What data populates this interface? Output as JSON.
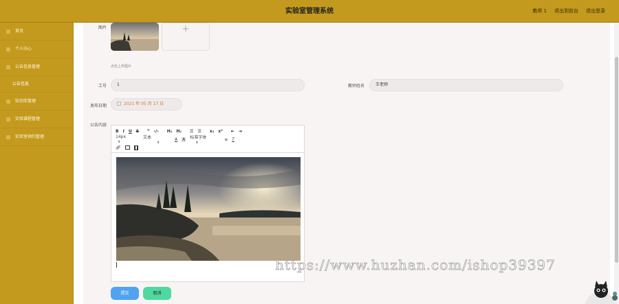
{
  "header": {
    "title": "实验室管理系统",
    "user_label": "教师 1",
    "back_to_front": "退出到前台",
    "logout": "退出登录"
  },
  "sidebar": {
    "items": [
      {
        "label": "首页",
        "icon": "home-icon"
      },
      {
        "label": "个人中心",
        "icon": "user-icon"
      },
      {
        "label": "公告信息管理",
        "icon": "notice-icon"
      },
      {
        "label": "公告信息",
        "sub": true
      },
      {
        "label": "知识库管理",
        "icon": "book-icon"
      },
      {
        "label": "实验课程管理",
        "icon": "course-icon"
      },
      {
        "label": "实验室预约管理",
        "icon": "calendar-icon"
      }
    ]
  },
  "form": {
    "image_label": "图片",
    "upload_plus": "+",
    "upload_hint": "点击上传图片",
    "job_no_label": "工号",
    "job_no_value": "1",
    "teacher_name_label": "教师姓名",
    "teacher_name_value": "王老师",
    "publish_date_label": "发布日期",
    "publish_date_value": "2021 年 05 月 17 日",
    "content_label": "公告内容",
    "submit_label": "提交",
    "cancel_label": "取消"
  },
  "editor": {
    "toolbar_row1": [
      "B",
      "I",
      "U",
      "S",
      "❞",
      "‹/›",
      "H₁",
      "H₂",
      "☰",
      "☰",
      "x₂",
      "x²",
      "⇤",
      "⇥"
    ],
    "font_size": "14px",
    "text_style": "文本",
    "font_family": "标准字体",
    "color_a": "A",
    "color_bg": "A",
    "clear_format": "T"
  },
  "watermark": "https://www.huzhan.com/ishop39397",
  "colors": {
    "header_bg": "#c49a1e",
    "sidebar_bg": "#c49a1e",
    "submit_bg": "#4fa3f0",
    "cancel_bg": "#4fd8a0",
    "date_text": "#e0703a"
  }
}
